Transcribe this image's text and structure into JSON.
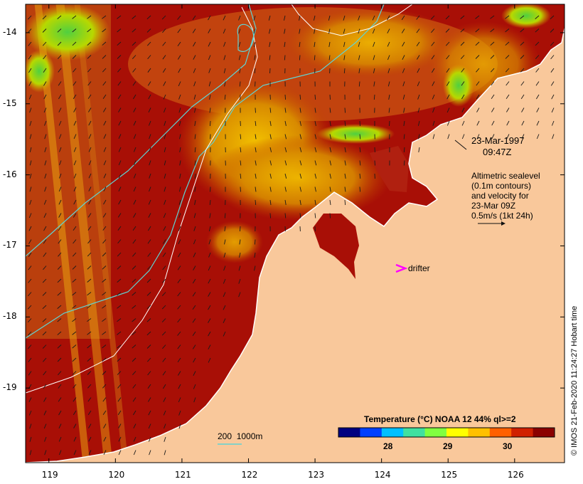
{
  "map": {
    "lon_ticks": [
      "119",
      "120",
      "121",
      "122",
      "123",
      "124",
      "125",
      "126"
    ],
    "lat_ticks": [
      "-14",
      "-15",
      "-16",
      "-17",
      "-18",
      "-19"
    ],
    "lon_range": [
      118.65,
      126.75
    ],
    "lat_range": [
      -20.05,
      -13.6
    ]
  },
  "annotations": {
    "date": "23-Mar-1997",
    "time": "09:47Z",
    "altimetry_lines": [
      "Altimetric sealevel",
      "(0.1m contours)",
      "and velocity for",
      "23-Mar 09Z",
      "0.5m/s (1kt 24h)"
    ],
    "drifter_label": "drifter",
    "bathymetry_legend": "200  1000m"
  },
  "colorbar": {
    "title": "Temperature (°C) NOAA 12 44% ql>=2",
    "ticks": [
      "28",
      "29",
      "30"
    ],
    "colors": [
      "#000080",
      "#0040ff",
      "#00c0ff",
      "#40e0a0",
      "#80ff40",
      "#ffff00",
      "#ffc000",
      "#ff6000",
      "#d02000",
      "#8b0000"
    ]
  },
  "copyright": "© IMOS 21-Feb-2020 11:24:27 Hobart time",
  "colors": {
    "land": "#f9c89b",
    "sea_warm": "#a80f06",
    "contour": "#5fd4d4",
    "drifter": "#ff00ff"
  }
}
